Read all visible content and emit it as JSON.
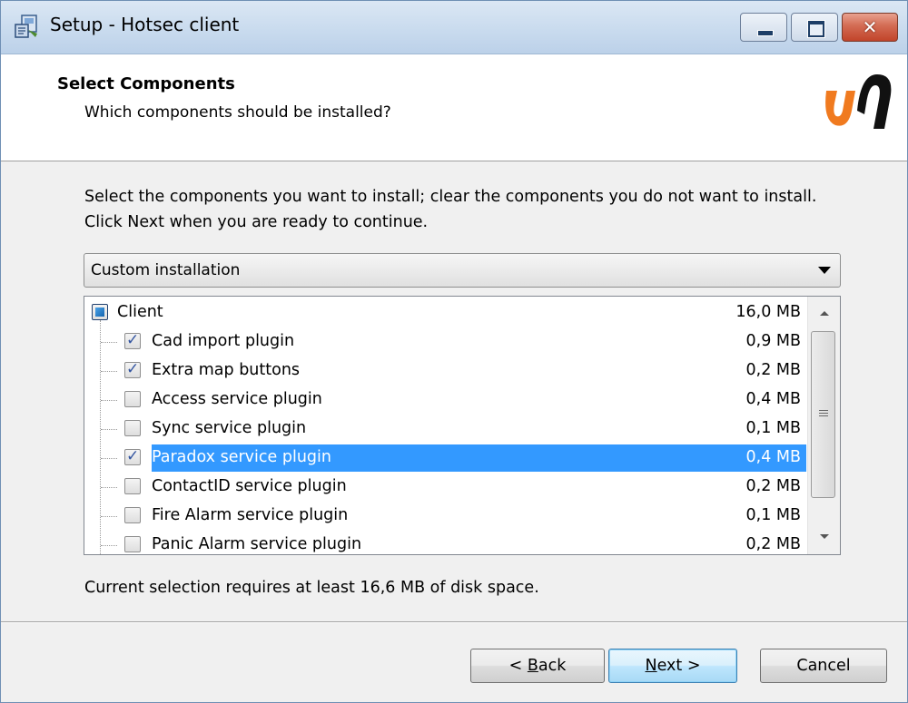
{
  "window": {
    "title": "Setup - Hotsec client",
    "icon": "setup-installer-icon"
  },
  "header": {
    "title": "Select Components",
    "subtitle": "Which components should be installed?",
    "logo_colors": [
      "#f07a1f",
      "#111111"
    ]
  },
  "intro_text": "Select the components you want to install; clear the components you do not want to install. Click Next when you are ready to continue.",
  "install_type": {
    "selected": "Custom installation"
  },
  "components": [
    {
      "label": "Client",
      "size": "16,0 MB",
      "state": "partial",
      "level": 0
    },
    {
      "label": "Cad import plugin",
      "size": "0,9 MB",
      "state": "checked",
      "level": 1
    },
    {
      "label": "Extra map buttons",
      "size": "0,2 MB",
      "state": "checked",
      "level": 1
    },
    {
      "label": "Access service plugin",
      "size": "0,4 MB",
      "state": "unchecked",
      "level": 1
    },
    {
      "label": "Sync service plugin",
      "size": "0,1 MB",
      "state": "unchecked",
      "level": 1
    },
    {
      "label": "Paradox service plugin",
      "size": "0,4 MB",
      "state": "checked",
      "level": 1,
      "selected": true
    },
    {
      "label": "ContactID service plugin",
      "size": "0,2 MB",
      "state": "unchecked",
      "level": 1
    },
    {
      "label": "Fire Alarm service plugin",
      "size": "0,1 MB",
      "state": "unchecked",
      "level": 1
    },
    {
      "label": "Panic Alarm service plugin",
      "size": "0,2 MB",
      "state": "unchecked",
      "level": 1
    }
  ],
  "disk_space_text": "Current selection requires at least 16,6 MB of disk space.",
  "buttons": {
    "back": {
      "prefix": "< ",
      "accel": "B",
      "rest": "ack"
    },
    "next": {
      "accel": "N",
      "rest": "ext >"
    },
    "cancel": "Cancel"
  },
  "colors": {
    "selection": "#3399ff",
    "accent_orange": "#f07a1f"
  }
}
